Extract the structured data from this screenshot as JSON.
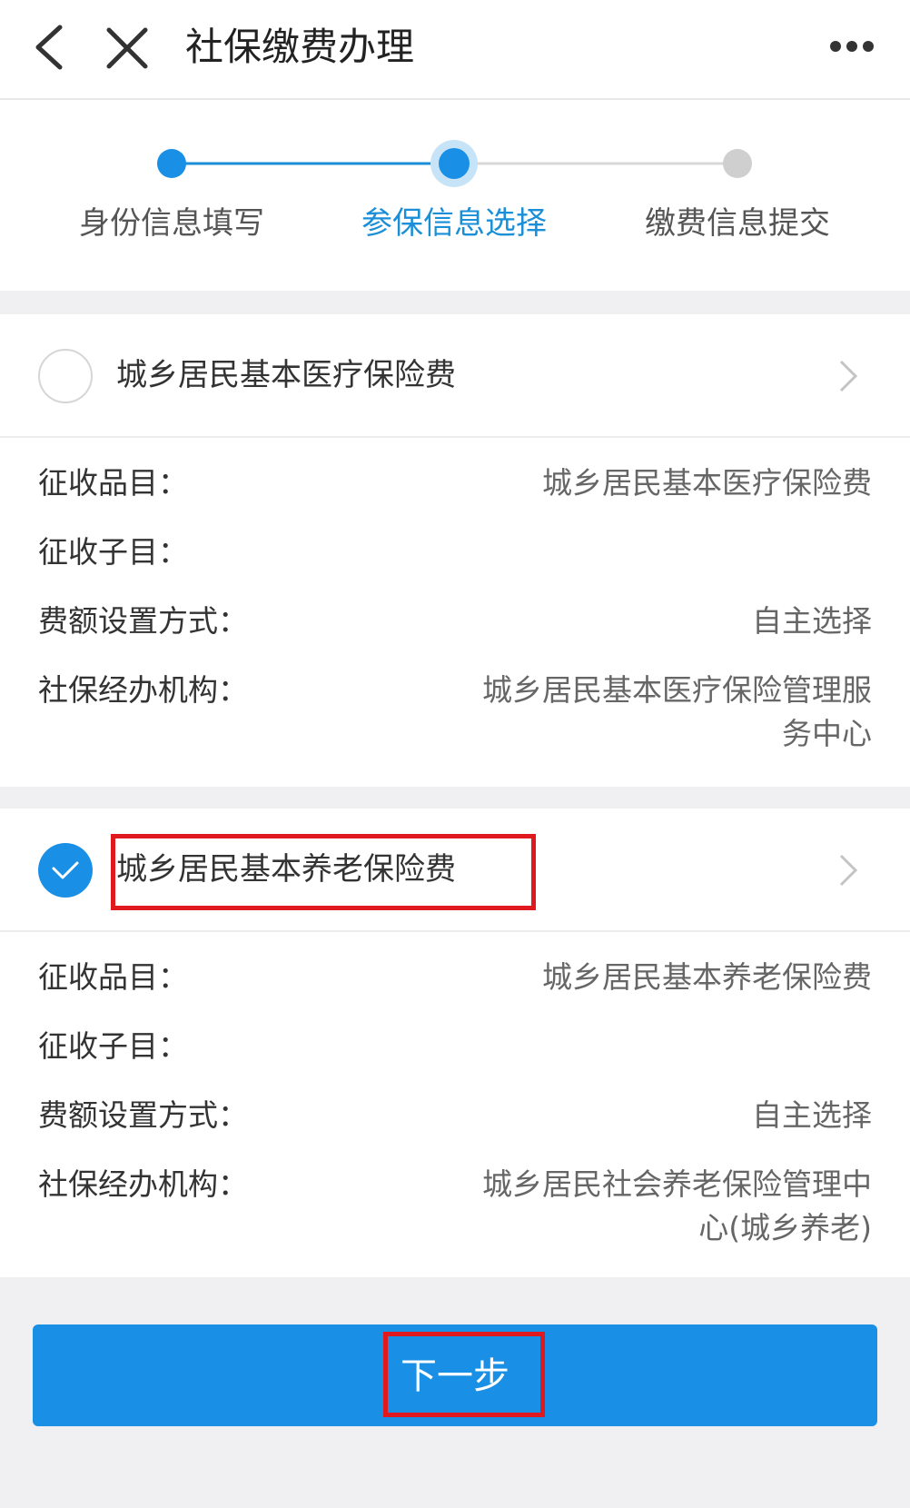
{
  "nav": {
    "title": "社保缴费办理",
    "back_icon": "chevron-left-icon",
    "close_icon": "close-icon",
    "more_icon": "more-horizontal-icon"
  },
  "steps": [
    {
      "label": "身份信息填写",
      "state": "done"
    },
    {
      "label": "参保信息选择",
      "state": "active"
    },
    {
      "label": "缴费信息提交",
      "state": "pending"
    }
  ],
  "cards": [
    {
      "title": "城乡居民基本医疗保险费",
      "selected": false,
      "rows": [
        {
          "label": "征收品目：",
          "value": "城乡居民基本医疗保险费"
        },
        {
          "label": "征收子目：",
          "value": ""
        },
        {
          "label": "费额设置方式：",
          "value": "自主选择"
        },
        {
          "label": "社保经办机构：",
          "value_lines": [
            "城乡居民基本医疗保险管理服",
            "务中心"
          ]
        }
      ]
    },
    {
      "title": "城乡居民基本养老保险费",
      "selected": true,
      "rows": [
        {
          "label": "征收品目：",
          "value": "城乡居民基本养老保险费"
        },
        {
          "label": "征收子目：",
          "value": ""
        },
        {
          "label": "费额设置方式：",
          "value": "自主选择"
        },
        {
          "label": "社保经办机构：",
          "value_lines": [
            "城乡居民社会养老保险管理中",
            "心(城乡养老)"
          ]
        }
      ]
    }
  ],
  "next_button": {
    "label": "下一步"
  },
  "colors": {
    "accent": "#1a8fe6",
    "highlight": "#e0191f"
  }
}
